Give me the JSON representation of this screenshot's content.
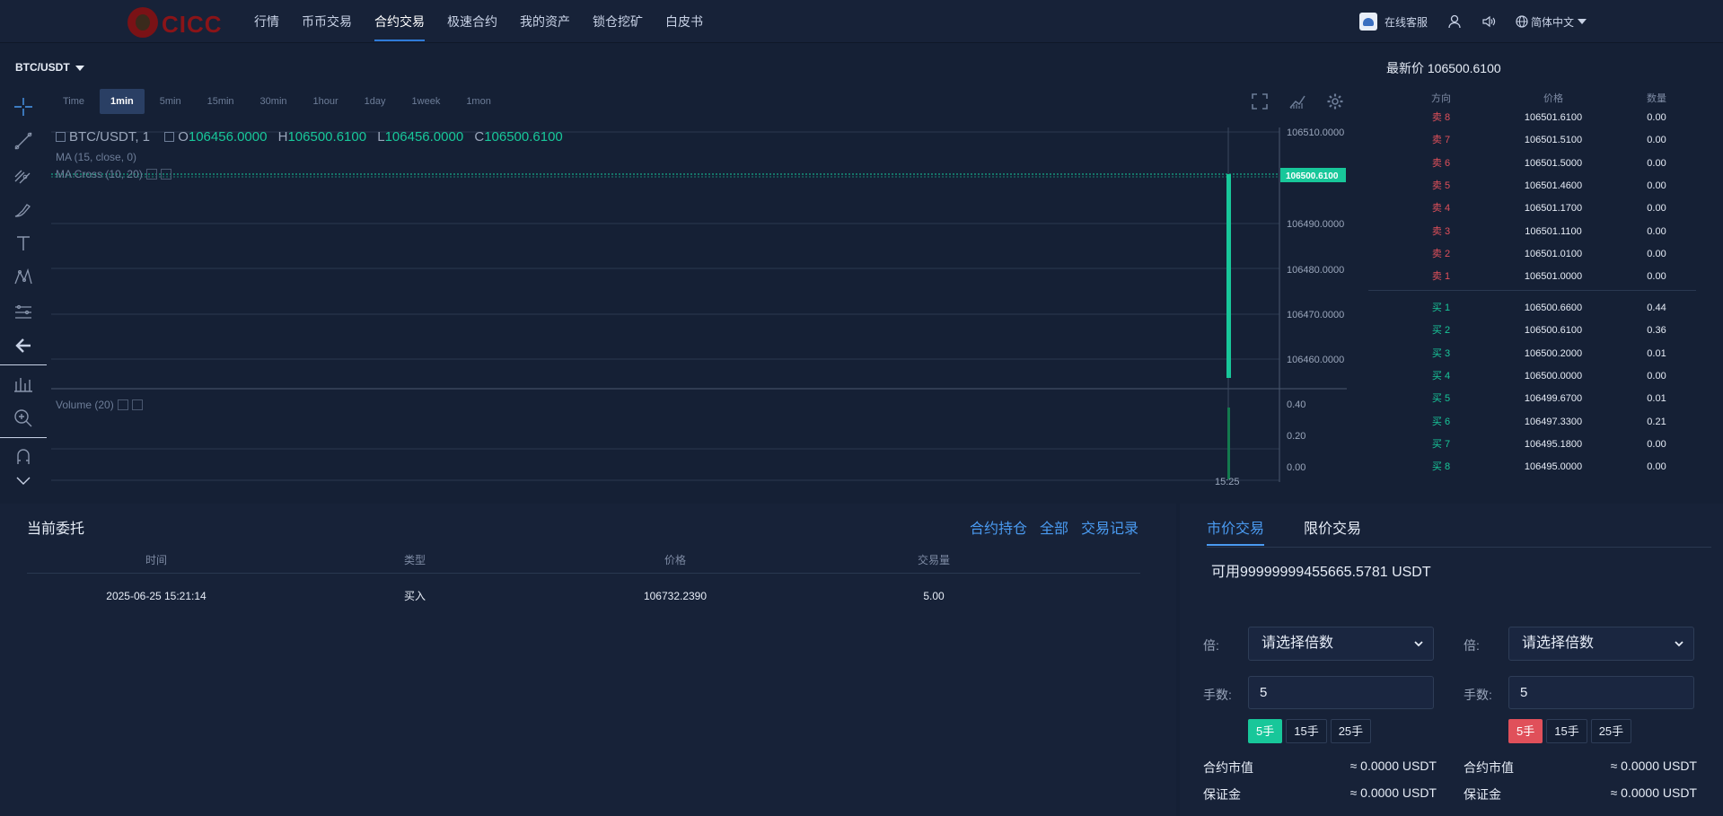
{
  "brand": {
    "logo_text": "CICC"
  },
  "nav": {
    "items": [
      "行情",
      "币币交易",
      "合约交易",
      "极速合约",
      "我的资产",
      "锁仓挖矿",
      "白皮书"
    ],
    "active": "合约交易",
    "service": "在线客服",
    "language": "简体中文"
  },
  "chart": {
    "pair": "BTC/USDT",
    "intervals": [
      "Time",
      "1min",
      "5min",
      "15min",
      "30min",
      "1hour",
      "1day",
      "1week",
      "1mon"
    ],
    "active_interval": "1min",
    "legend": {
      "symbol": "BTC/USDT, 1",
      "o_label": "O",
      "o": "106456.0000",
      "h_label": "H",
      "h": "106500.6100",
      "l_label": "L",
      "l": "106456.0000",
      "c_label": "C",
      "c": "106500.6100",
      "ma": "MA (15, close, 0)",
      "ma_cross": "MA Cross (10, 20)",
      "volume": "Volume (20)"
    },
    "price_ticks": [
      "106510.0000",
      "106500.6100",
      "106490.0000",
      "106480.0000",
      "106470.0000",
      "106460.0000"
    ],
    "current_price": "106500.6100",
    "volume_ticks": [
      "0.40",
      "0.20",
      "0.00"
    ],
    "time_label": "15:25"
  },
  "orderbook": {
    "title": "最新价 106500.6100",
    "headers": [
      "方向",
      "价格",
      "数量"
    ],
    "asks": [
      {
        "side": "卖 8",
        "price": "106501.6100",
        "qty": "0.00"
      },
      {
        "side": "卖 7",
        "price": "106501.5100",
        "qty": "0.00"
      },
      {
        "side": "卖 6",
        "price": "106501.5000",
        "qty": "0.00"
      },
      {
        "side": "卖 5",
        "price": "106501.4600",
        "qty": "0.00"
      },
      {
        "side": "卖 4",
        "price": "106501.1700",
        "qty": "0.00"
      },
      {
        "side": "卖 3",
        "price": "106501.1100",
        "qty": "0.00"
      },
      {
        "side": "卖 2",
        "price": "106501.0100",
        "qty": "0.00"
      },
      {
        "side": "卖 1",
        "price": "106501.0000",
        "qty": "0.00"
      }
    ],
    "bids": [
      {
        "side": "买 1",
        "price": "106500.6600",
        "qty": "0.44"
      },
      {
        "side": "买 2",
        "price": "106500.6100",
        "qty": "0.36"
      },
      {
        "side": "买 3",
        "price": "106500.2000",
        "qty": "0.01"
      },
      {
        "side": "买 4",
        "price": "106500.0000",
        "qty": "0.00"
      },
      {
        "side": "买 5",
        "price": "106499.6700",
        "qty": "0.01"
      },
      {
        "side": "买 6",
        "price": "106497.3300",
        "qty": "0.21"
      },
      {
        "side": "买 7",
        "price": "106495.1800",
        "qty": "0.00"
      },
      {
        "side": "买 8",
        "price": "106495.0000",
        "qty": "0.00"
      }
    ]
  },
  "orders": {
    "title": "当前委托",
    "links": [
      "合约持仓",
      "全部",
      "交易记录"
    ],
    "headers": [
      "时间",
      "类型",
      "价格",
      "交易量"
    ],
    "rows": [
      {
        "time": "2025-06-25 15:21:14",
        "type": "买入",
        "price": "106732.2390",
        "volume": "5.00"
      }
    ]
  },
  "trade": {
    "tabs": [
      "市价交易",
      "限价交易"
    ],
    "active_tab": "市价交易",
    "available": "可用99999999455665.5781 USDT",
    "leverage_label": "倍:",
    "leverage_placeholder": "请选择倍数",
    "lots_label": "手数:",
    "lots_value": "5",
    "quick": [
      "5手",
      "15手",
      "25手"
    ],
    "contract_value_label": "合约市值",
    "contract_value": "≈ 0.0000 USDT",
    "margin_label": "保证金",
    "margin_value": "≈ 0.0000 USDT"
  },
  "colors": {
    "buy": "#18c79a",
    "sell": "#e0505a",
    "accent": "#4a9af0"
  }
}
